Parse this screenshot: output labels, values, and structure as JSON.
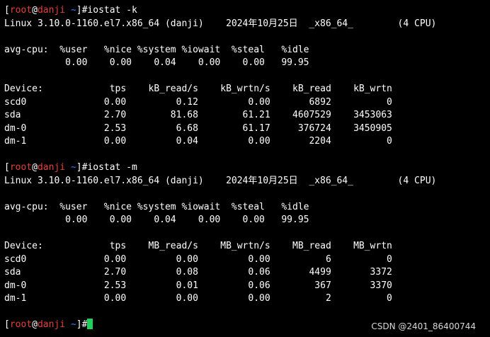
{
  "colors": {
    "background": "#000000",
    "text": "#ffffff",
    "prompt_user": "#e2403a",
    "prompt_path": "#3b78ff",
    "cursor": "#1fd15a"
  },
  "prompt": {
    "open": "[",
    "user": "root",
    "at": "@",
    "host": "danji",
    "space": " ",
    "path": "~",
    "close": "]#"
  },
  "blocks": [
    {
      "command": "iostat -k",
      "header": "Linux 3.10.0-1160.el7.x86_64 (danji)    2024年10月25日  _x86_64_        (4 CPU)",
      "cpu_header": "avg-cpu:  %user   %nice %system %iowait  %steal   %idle",
      "cpu_values": "           0.00    0.00    0.04    0.00    0.00   99.95",
      "device_header": "Device:            tps    kB_read/s    kB_wrtn/s    kB_read    kB_wrtn",
      "rows": [
        "scd0              0.00         0.12         0.00       6892          0",
        "sda               2.70        81.68        61.21    4607529    3453063",
        "dm-0              2.53         6.68        61.17     376724    3450905",
        "dm-1              0.00         0.04         0.00       2204          0"
      ]
    },
    {
      "command": "iostat -m",
      "header": "Linux 3.10.0-1160.el7.x86_64 (danji)    2024年10月25日  _x86_64_        (4 CPU)",
      "cpu_header": "avg-cpu:  %user   %nice %system %iowait  %steal   %idle",
      "cpu_values": "           0.00    0.00    0.04    0.00    0.00   99.95",
      "device_header": "Device:            tps    MB_read/s    MB_wrtn/s    MB_read    MB_wrtn",
      "rows": [
        "scd0              0.00         0.00         0.00          6          0",
        "sda               2.70         0.08         0.06       4499       3372",
        "dm-0              2.53         0.01         0.06        367       3370",
        "dm-1              0.00         0.00         0.00          2          0"
      ]
    }
  ],
  "watermark": "CSDN @2401_86400744"
}
